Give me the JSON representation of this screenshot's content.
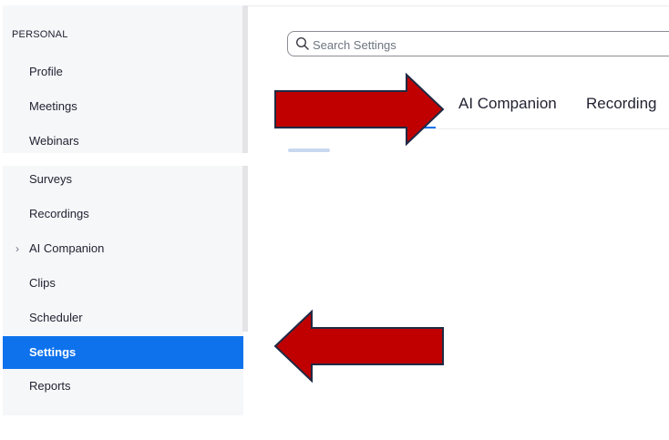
{
  "sidebar": {
    "section_label": "PERSONAL",
    "items": [
      {
        "label": "Profile"
      },
      {
        "label": "Meetings"
      },
      {
        "label": "Webinars"
      },
      {
        "label": "Surveys"
      },
      {
        "label": "Recordings"
      },
      {
        "label": "AI Companion",
        "has_chevron": true
      },
      {
        "label": "Clips"
      },
      {
        "label": "Scheduler"
      },
      {
        "label": "Settings",
        "active": true
      },
      {
        "label": "Reports"
      }
    ],
    "chevron_glyph": "›"
  },
  "search": {
    "placeholder": "Search Settings",
    "value": ""
  },
  "tabs": [
    {
      "label": "AI Companion"
    },
    {
      "label": "Recording"
    }
  ],
  "annotations": {
    "arrow_color": "#c00000",
    "arrow_outline": "#1f2a44"
  },
  "colors": {
    "accent": "#0e72ed",
    "sidebar_bg": "#f6f7f9"
  }
}
